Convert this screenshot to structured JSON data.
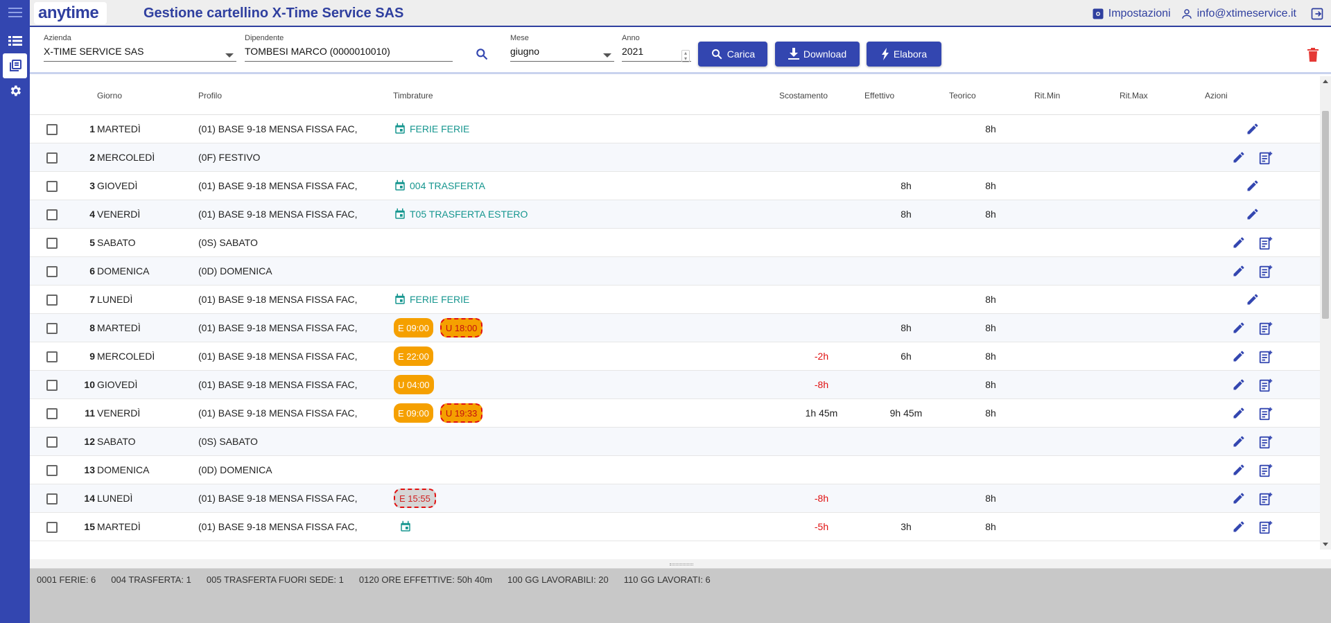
{
  "header": {
    "title": "Gestione cartellino X-Time Service SAS",
    "settings_label": "Impostazioni",
    "user_email": "info@xtimeservice.it",
    "logo_text": "anytime"
  },
  "filters": {
    "azienda": {
      "label": "Azienda",
      "value": "X-TIME SERVICE SAS"
    },
    "dipendente": {
      "label": "Dipendente",
      "value": "TOMBESI MARCO (0000010010)"
    },
    "mese": {
      "label": "Mese",
      "value": "giugno"
    },
    "anno": {
      "label": "Anno",
      "value": "2021"
    },
    "buttons": {
      "carica": "Carica",
      "download": "Download",
      "elabora": "Elabora"
    }
  },
  "table": {
    "headers": {
      "giorno": "Giorno",
      "profilo": "Profilo",
      "timbrature": "Timbrature",
      "scostamento": "Scostamento",
      "effettivo": "Effettivo",
      "teorico": "Teorico",
      "ritmin": "Rit.Min",
      "ritmax": "Rit.Max",
      "azioni": "Azioni"
    },
    "rows": [
      {
        "n": "1",
        "giorno": "MARTEDÌ",
        "profilo": "(01) BASE 9-18 MENSA FISSA FAC,",
        "just": "FERIE FERIE",
        "scost": "",
        "eff": "",
        "teor": "8h"
      },
      {
        "n": "2",
        "giorno": "MERCOLEDÌ",
        "profilo": "(0F) FESTIVO",
        "just": "",
        "scost": "",
        "eff": "",
        "teor": ""
      },
      {
        "n": "3",
        "giorno": "GIOVEDÌ",
        "profilo": "(01) BASE 9-18 MENSA FISSA FAC,",
        "just": "004 TRASFERTA",
        "scost": "",
        "eff": "8h",
        "teor": "8h"
      },
      {
        "n": "4",
        "giorno": "VENERDÌ",
        "profilo": "(01) BASE 9-18 MENSA FISSA FAC,",
        "just": "T05 TRASFERTA ESTERO",
        "scost": "",
        "eff": "8h",
        "teor": "8h"
      },
      {
        "n": "5",
        "giorno": "SABATO",
        "profilo": "(0S) SABATO",
        "just": "",
        "scost": "",
        "eff": "",
        "teor": ""
      },
      {
        "n": "6",
        "giorno": "DOMENICA",
        "profilo": "(0D) DOMENICA",
        "just": "",
        "scost": "",
        "eff": "",
        "teor": ""
      },
      {
        "n": "7",
        "giorno": "LUNEDÌ",
        "profilo": "(01) BASE 9-18 MENSA FISSA FAC,",
        "just": "FERIE FERIE",
        "scost": "",
        "eff": "",
        "teor": "8h"
      },
      {
        "n": "8",
        "giorno": "MARTEDÌ",
        "profilo": "(01) BASE 9-18 MENSA FISSA FAC,",
        "badge1": "E 09:00",
        "badge2": "U 18:00",
        "scost": "",
        "eff": "8h",
        "teor": "8h"
      },
      {
        "n": "9",
        "giorno": "MERCOLEDÌ",
        "profilo": "(01) BASE 9-18 MENSA FISSA FAC,",
        "badge1": "E 22:00",
        "scost": "-2h",
        "eff": "6h",
        "teor": "8h"
      },
      {
        "n": "10",
        "giorno": "GIOVEDÌ",
        "profilo": "(01) BASE 9-18 MENSA FISSA FAC,",
        "badge1": "U 04:00",
        "scost": "-8h",
        "eff": "",
        "teor": "8h"
      },
      {
        "n": "11",
        "giorno": "VENERDÌ",
        "profilo": "(01) BASE 9-18 MENSA FISSA FAC,",
        "badge1": "E 09:00",
        "badge2": "U 19:33",
        "scost": "1h 45m",
        "eff": "9h 45m",
        "teor": "8h"
      },
      {
        "n": "12",
        "giorno": "SABATO",
        "profilo": "(0S) SABATO",
        "scost": "",
        "eff": "",
        "teor": ""
      },
      {
        "n": "13",
        "giorno": "DOMENICA",
        "profilo": "(0D) DOMENICA",
        "scost": "",
        "eff": "",
        "teor": ""
      },
      {
        "n": "14",
        "giorno": "LUNEDÌ",
        "profilo": "(01) BASE 9-18 MENSA FISSA FAC,",
        "badge1": "E 15:55",
        "scost": "-8h",
        "eff": "",
        "teor": "8h"
      },
      {
        "n": "15",
        "giorno": "MARTEDÌ",
        "profilo": "(01) BASE 9-18 MENSA FISSA FAC,",
        "scost": "-5h",
        "eff": "3h",
        "teor": "8h"
      }
    ]
  },
  "totals": [
    "0001 FERIE: 6",
    "004 TRASFERTA: 1",
    "005 TRASFERTA FUORI SEDE: 1",
    "0120 ORE EFFETTIVE: 50h 40m",
    "100 GG LAVORABILI: 20",
    "110 GG LAVORATI: 6"
  ],
  "colors": {
    "primary": "#3346b0",
    "accent_teal": "#16968f",
    "badge_orange": "#f5a000",
    "error_red": "#e01010"
  }
}
